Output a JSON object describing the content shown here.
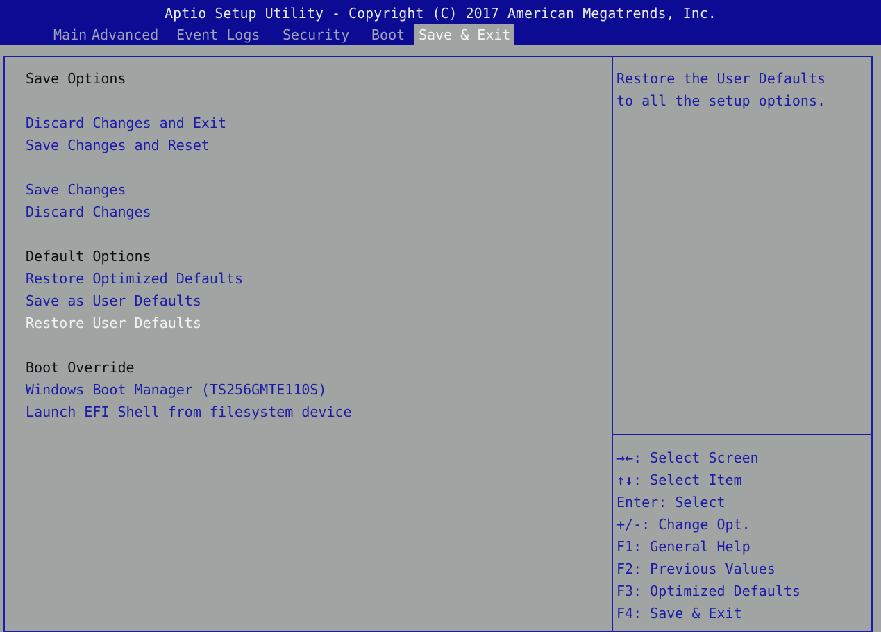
{
  "header": {
    "title": "Aptio Setup Utility - Copyright (C) 2017 American Megatrends, Inc."
  },
  "tabs": [
    {
      "label": "Main"
    },
    {
      "label": "Advanced"
    },
    {
      "label": "Event Logs"
    },
    {
      "label": "Security"
    },
    {
      "label": "Boot"
    },
    {
      "label": "Save & Exit",
      "active": true
    }
  ],
  "sections": {
    "save_options": {
      "heading": "Save Options",
      "discard_exit": "Discard Changes and Exit",
      "save_reset": "Save Changes and Reset",
      "save_changes": "Save Changes",
      "discard_changes": "Discard Changes"
    },
    "default_options": {
      "heading": "Default Options",
      "restore_optimized": "Restore Optimized Defaults",
      "save_user": "Save as User Defaults",
      "restore_user": "Restore User Defaults"
    },
    "boot_override": {
      "heading": "Boot Override",
      "windows_boot": "Windows Boot Manager (TS256GMTE110S)",
      "efi_shell": "Launch EFI Shell from filesystem device"
    }
  },
  "help": {
    "line1": "Restore the User Defaults",
    "line2": "to all the setup options."
  },
  "keys": [
    {
      "glyph": "→←",
      "text": ": Select Screen"
    },
    {
      "glyph": "↑↓",
      "text": ": Select Item"
    },
    {
      "glyph": "",
      "text": "Enter: Select"
    },
    {
      "glyph": "",
      "text": "+/-: Change Opt."
    },
    {
      "glyph": "",
      "text": "F1: General Help"
    },
    {
      "glyph": "",
      "text": "F2: Previous Values"
    },
    {
      "glyph": "",
      "text": "F3: Optimized Defaults"
    },
    {
      "glyph": "",
      "text": "F4: Save & Exit"
    }
  ],
  "colors": {
    "header_blue": "#0b0b94",
    "background_gray": "#a0a5a4",
    "item_blue": "#1c1ca8",
    "selected_white": "#f2f2f2"
  },
  "selected_item": "Restore User Defaults"
}
